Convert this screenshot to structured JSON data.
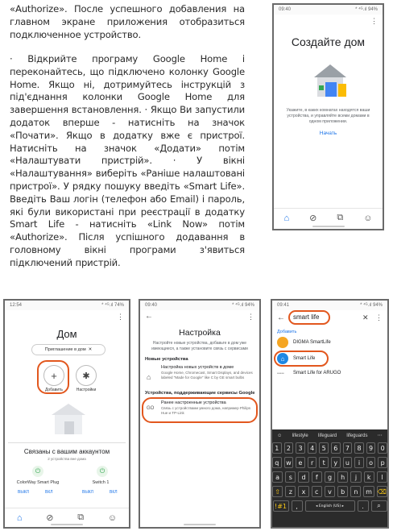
{
  "instructions": {
    "paragraph1": "«Authorize». После успешного добавления на главном экране приложения отобразиться подключенное устройство.",
    "paragraph2": "· Відкрийте програму Google Home і переконайтесь, що підключено колонку Google Home. Якщо ні, дотримуйтесь інструкцій з під'єднання колонки Google Home для завершення встановлення. · Якщо Ви запустили додаток вперше - натисніть на значок «Почати». Якщо в додатку вже є пристрої. Натисніть на значок «Додати» потім «Налаштувати пристрій». · У вікні «Налаштування» виберіть «Раніше налаштовані пристрої». У рядку пошуку введіть «Smart Life». Введіть Ваш логін (телефон або Email) і пароль, які були використані при реєстрації в додатку Smart Life - натисніть «Link Now» потім «Authorize». Після успішного додавання в головному вікні програми з'явиться підключений пристрій."
  },
  "screen1": {
    "status_time": "09:40",
    "status_right": "* ⁴ᴳ.ıl 94%",
    "title": "Создайте дом",
    "description": "Укажите, в каких комнатах находятся ваши устройства, и управляйте всеми домами в одном приложении.",
    "start_label": "Начать"
  },
  "screen2": {
    "status_time": "12:54",
    "status_right": "* ⁴ᴳ.ıl 74%",
    "title": "Дом",
    "invite_chip": "Приглашение в дом",
    "add_label": "Добавить",
    "settings_label": "Настройки",
    "linked_title": "Связаны с вашим аккаунтом",
    "linked_subtitle": "2 устройства вне дома",
    "device1_name": "ColorWay Smart Plug",
    "device2_name": "Switch 1",
    "off_label": "ВЫКЛ",
    "on_label": "ВКЛ"
  },
  "screen3": {
    "status_time": "09:40",
    "status_right": "* ⁴ᴳ.ıl 94%",
    "title": "Настройка",
    "intro": "Настройте новые устройства, добавьте в дом уже имеющиеся, а также установите связь с сервисами",
    "new_devices_header": "Новые устройства",
    "item1_title": "Настройка новых устройств в доме",
    "item1_desc": "Google Home, Chromecast, Smart Displays, and devices labeled \"Made for Google\" like C by GE smart bulbs",
    "google_services_header": "Устройства, поддерживающие сервисы Google",
    "item2_title": "Ранее настроенные устройства",
    "item2_desc": "Связь с устройствами умного дома, например Philips Hue и TP-Link",
    "item2_icon": "GO"
  },
  "screen4": {
    "status_time": "09:41",
    "status_right": "* ⁴ᴳ.ıl 94%",
    "search_value": "smart life",
    "added_label": "Добавить",
    "result1": "DIGMA SmartLife",
    "result2": "Smart Life",
    "result3": "Smart Life for ARUGO",
    "suggestions": [
      "lifestyle",
      "lifeguard",
      "lifeguards"
    ],
    "kb_row1": [
      "1",
      "2",
      "3",
      "4",
      "5",
      "6",
      "7",
      "8",
      "9",
      "0"
    ],
    "kb_row2": [
      "q",
      "w",
      "e",
      "r",
      "t",
      "y",
      "u",
      "i",
      "o",
      "p"
    ],
    "kb_row3": [
      "a",
      "s",
      "d",
      "f",
      "g",
      "h",
      "j",
      "k",
      "l"
    ],
    "kb_row4": [
      "z",
      "x",
      "c",
      "v",
      "b",
      "n",
      "m"
    ],
    "kb_sym": "!#1",
    "kb_space": "◂ English (US) ▸",
    "kb_comma": ","
  },
  "colors": {
    "accent_orange": "#e2571e",
    "google_blue": "#1a73e8",
    "keyboard_bg": "#2b2b2b"
  }
}
